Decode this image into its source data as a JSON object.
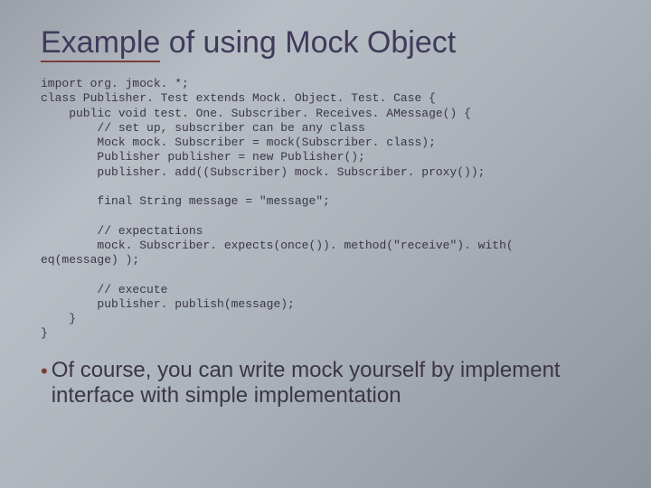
{
  "title": {
    "underlined": "Example",
    "rest": " of using Mock Object"
  },
  "code": "import org. jmock. *;\nclass Publisher. Test extends Mock. Object. Test. Case {\n    public void test. One. Subscriber. Receives. AMessage() {\n        // set up, subscriber can be any class\n        Mock mock. Subscriber = mock(Subscriber. class);\n        Publisher publisher = new Publisher();\n        publisher. add((Subscriber) mock. Subscriber. proxy());\n\n        final String message = \"message\";\n\n        // expectations\n        mock. Subscriber. expects(once()). method(\"receive\"). with(\neq(message) );\n\n        // execute\n        publisher. publish(message);\n    }\n}",
  "bullet": "•",
  "note": "Of course, you can write mock yourself by implement interface with simple implementation"
}
